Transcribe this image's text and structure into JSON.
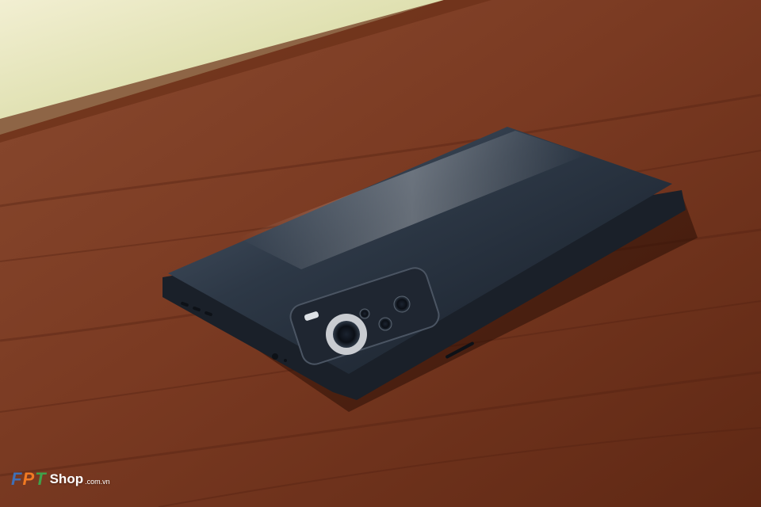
{
  "photo": {
    "subject": "smartphone lying face-down on a wooden table",
    "colors": {
      "phone_body": "#2a3340",
      "table_wood": "#7a3a22",
      "background_window": "#e6e2b8"
    }
  },
  "watermark": {
    "letters": [
      "F",
      "P",
      "T"
    ],
    "brand": "Shop",
    "domain": ".com.vn",
    "colors": {
      "f": "#3f6fb6",
      "p": "#f07a23",
      "t": "#3fa24a"
    }
  }
}
